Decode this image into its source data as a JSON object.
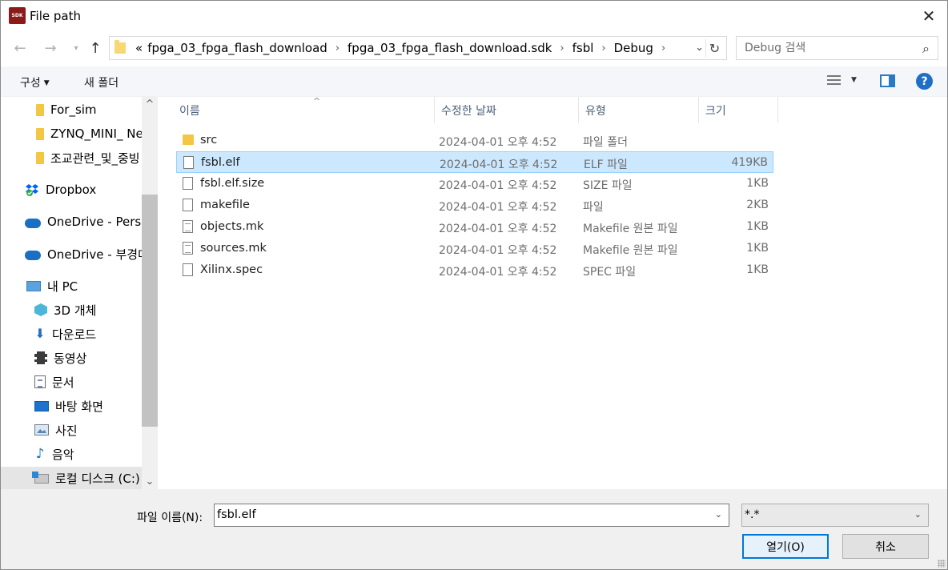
{
  "window": {
    "title": "File path",
    "app_icon_text": "SDK"
  },
  "nav": {
    "address": [
      "«",
      "fpga_03_fpga_flash_download",
      "fpga_03_fpga_flash_download.sdk",
      "fsbl",
      "Debug"
    ],
    "search_placeholder": "Debug 검색"
  },
  "toolbar": {
    "organize": "구성",
    "new_folder": "새 폴더"
  },
  "sidebar": {
    "items": [
      {
        "label": "For_sim",
        "icon": "folder-icon"
      },
      {
        "label": "ZYNQ_MINI_ Ne",
        "icon": "folder-icon"
      },
      {
        "label": "조교관련_및_중빙",
        "icon": "folder-icon"
      },
      {
        "label": "Dropbox",
        "icon": "dropbox-icon"
      },
      {
        "label": "OneDrive - Persor",
        "icon": "onedrive-icon"
      },
      {
        "label": "OneDrive - 부경대",
        "icon": "onedrive-icon"
      },
      {
        "label": "내 PC",
        "icon": "pc-icon"
      },
      {
        "label": "3D 개체",
        "icon": "cube-icon"
      },
      {
        "label": "다운로드",
        "icon": "download-icon"
      },
      {
        "label": "동영상",
        "icon": "video-icon"
      },
      {
        "label": "문서",
        "icon": "document-icon"
      },
      {
        "label": "바탕 화면",
        "icon": "desktop-icon"
      },
      {
        "label": "사진",
        "icon": "picture-icon"
      },
      {
        "label": "음악",
        "icon": "music-icon"
      },
      {
        "label": "로컬 디스크 (C:)",
        "icon": "drive-icon"
      }
    ]
  },
  "columns": {
    "name": "이름",
    "date": "수정한 날짜",
    "type": "유형",
    "size": "크기"
  },
  "files": [
    {
      "name": "src",
      "date": "2024-04-01 오후 4:52",
      "type": "파일 폴더",
      "size": "",
      "icon": "folder-icon"
    },
    {
      "name": "fsbl.elf",
      "date": "2024-04-01 오후 4:52",
      "type": "ELF 파일",
      "size": "419KB",
      "icon": "file-icon",
      "selected": true
    },
    {
      "name": "fsbl.elf.size",
      "date": "2024-04-01 오후 4:52",
      "type": "SIZE 파일",
      "size": "1KB",
      "icon": "file-icon"
    },
    {
      "name": "makefile",
      "date": "2024-04-01 오후 4:52",
      "type": "파일",
      "size": "2KB",
      "icon": "file-icon"
    },
    {
      "name": "objects.mk",
      "date": "2024-04-01 오후 4:52",
      "type": "Makefile 원본 파일",
      "size": "1KB",
      "icon": "makefile-icon"
    },
    {
      "name": "sources.mk",
      "date": "2024-04-01 오후 4:52",
      "type": "Makefile 원본 파일",
      "size": "1KB",
      "icon": "makefile-icon"
    },
    {
      "name": "Xilinx.spec",
      "date": "2024-04-01 오후 4:52",
      "type": "SPEC 파일",
      "size": "1KB",
      "icon": "file-icon"
    }
  ],
  "footer": {
    "filename_label": "파일 이름(N):",
    "filename_value": "fsbl.elf",
    "filter_value": "*.*",
    "open_label": "열기(O)",
    "cancel_label": "취소"
  }
}
